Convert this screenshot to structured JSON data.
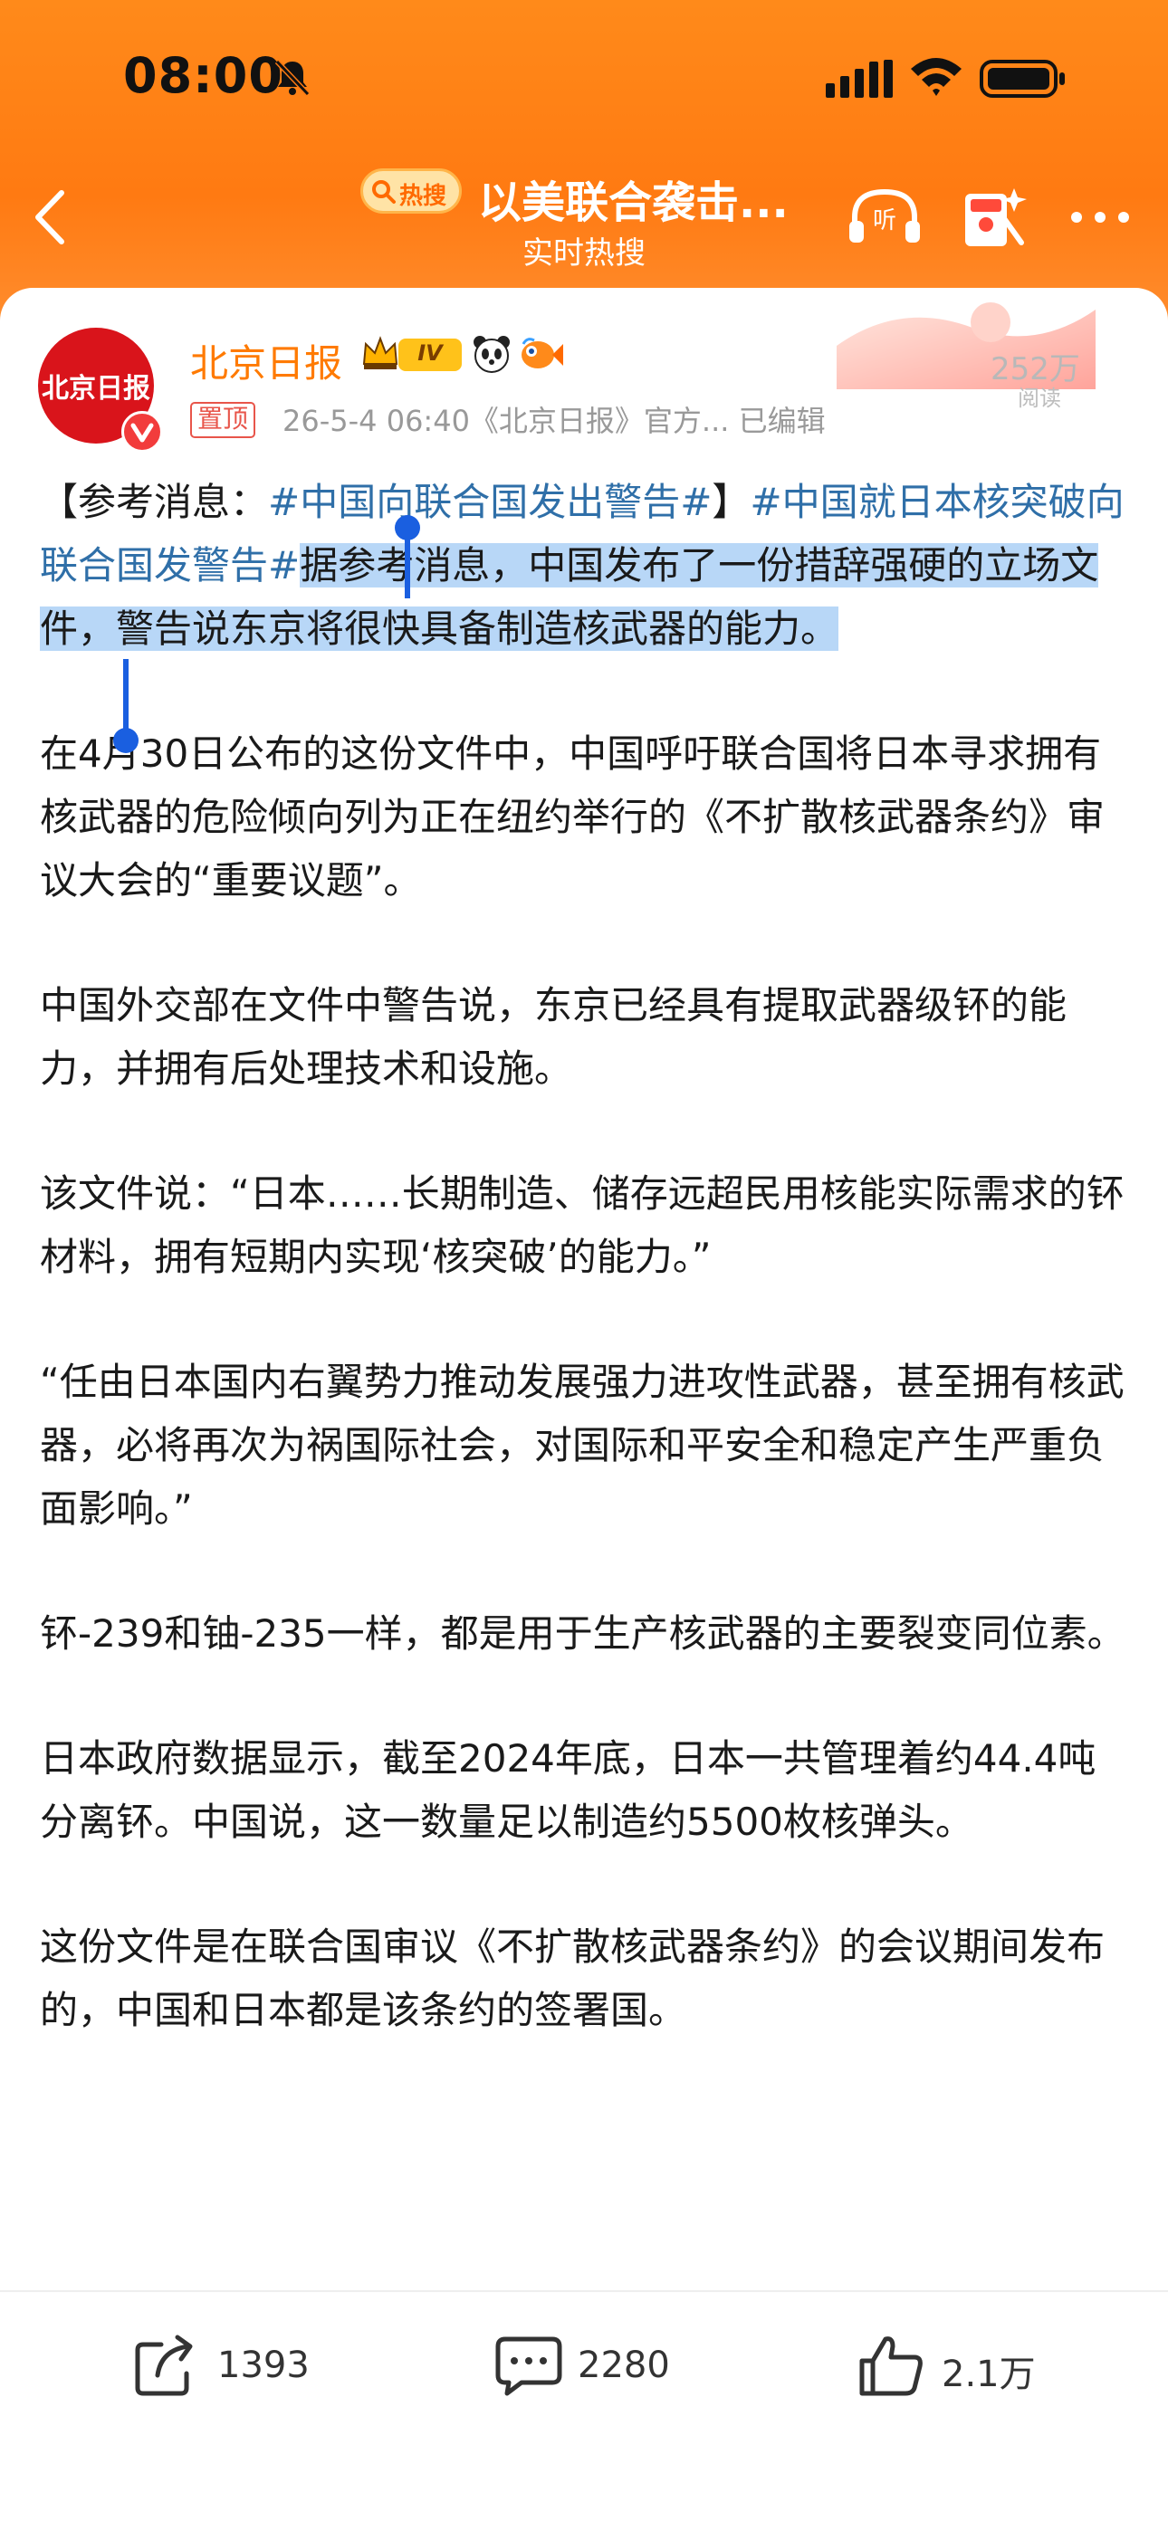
{
  "status_bar": {
    "time": "08:00"
  },
  "nav": {
    "hot_badge": "热搜",
    "title": "以美联合袭击...",
    "subtitle": "实时热搜"
  },
  "post": {
    "avatar_text": "北京日报",
    "account_name": "北京日报",
    "level": "IV",
    "read_count": "252万",
    "read_label": "阅读",
    "pinned": "置顶",
    "meta": "26-5-4 06:40《北京日报》官方...  已编辑",
    "p1": {
      "lead": "【参考消息：",
      "tag1": "#中国向联合国发出警告#",
      "bracket": "】",
      "tag2": "#中国就日本核突破向联合国发警告#",
      "text": "据参考消息，中国发布了一份措辞强硬的立场文件，警告说东京将很快具备制造核武器的能力。"
    },
    "paragraphs": [
      "在4月30日公布的这份文件中，中国呼吁联合国将日本寻求拥有核武器的危险倾向列为正在纽约举行的《不扩散核武器条约》审议大会的“重要议题”。",
      "中国外交部在文件中警告说，东京已经具有提取武器级钚的能力，并拥有后处理技术和设施。",
      "该文件说：“日本……长期制造、储存远超民用核能实际需求的钚材料，拥有短期内实现‘核突破’的能力。”",
      "“任由日本国内右翼势力推动发展强力进攻性武器，甚至拥有核武器，必将再次为祸国际社会，对国际和平安全和稳定产生严重负面影响。”",
      "钚-239和铀-235一样，都是用于生产核武器的主要裂变同位素。",
      "日本政府数据显示，截至2024年底，日本一共管理着约44.4吨分离钚。中国说，这一数量足以制造约5500枚核弹头。",
      "这份文件是在联合国审议《不扩散核武器条约》的会议期间发布的，中国和日本都是该条约的签署国。"
    ]
  },
  "actions": {
    "share": "1393",
    "comment": "2280",
    "like": "2.1万"
  },
  "colors": {
    "header": "#ff7a12",
    "accent": "#ff7a00",
    "hashtag": "#2f6fa8",
    "selection": "#b8d7f7"
  }
}
